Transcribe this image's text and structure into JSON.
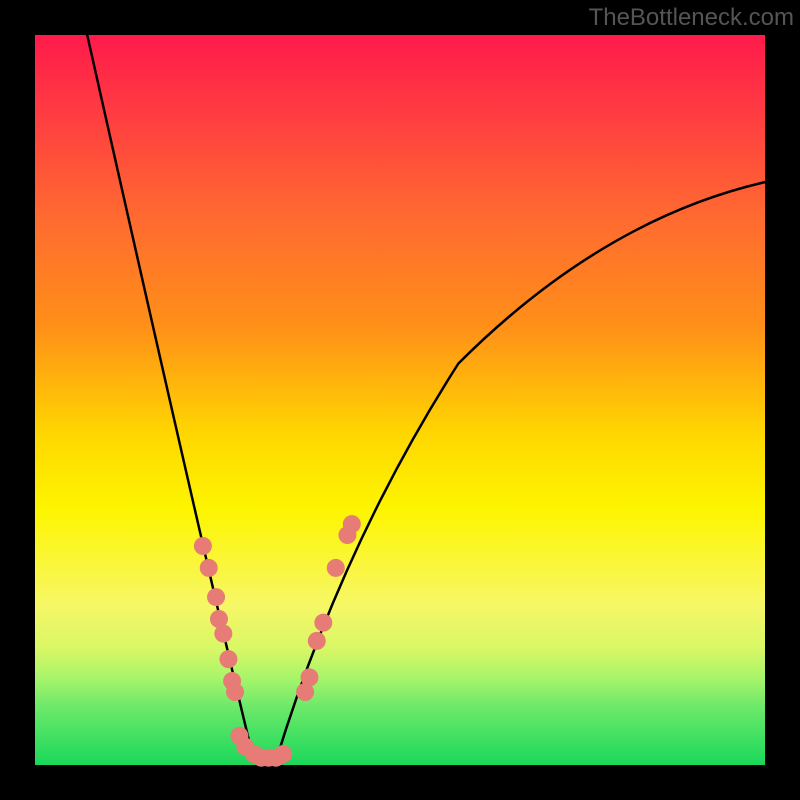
{
  "watermark": "TheBottleneck.com",
  "chart_data": {
    "type": "line",
    "title": "",
    "xlabel": "",
    "ylabel": "",
    "curve_left": {
      "description": "steep descending limb from top-left into the valley",
      "y_start_pct": 0,
      "y_end_pct": 100,
      "x_start_pct": 7,
      "x_end_pct": 30
    },
    "curve_right": {
      "description": "ascending limb from valley toward upper right, concave, flattening",
      "y_start_pct": 100,
      "y_end_pct": 20,
      "x_start_pct": 33,
      "x_end_pct": 100
    },
    "valley_x_pct": 31,
    "markers_left": [
      {
        "x_pct": 23.0,
        "y_pct": 70.0
      },
      {
        "x_pct": 23.8,
        "y_pct": 73.0
      },
      {
        "x_pct": 24.8,
        "y_pct": 77.0
      },
      {
        "x_pct": 25.2,
        "y_pct": 80.0
      },
      {
        "x_pct": 25.8,
        "y_pct": 82.0
      },
      {
        "x_pct": 26.5,
        "y_pct": 85.5
      },
      {
        "x_pct": 27.0,
        "y_pct": 88.5
      },
      {
        "x_pct": 27.4,
        "y_pct": 90.0
      }
    ],
    "markers_right": [
      {
        "x_pct": 37.0,
        "y_pct": 90.0
      },
      {
        "x_pct": 37.6,
        "y_pct": 88.0
      },
      {
        "x_pct": 38.6,
        "y_pct": 83.0
      },
      {
        "x_pct": 39.5,
        "y_pct": 80.5
      },
      {
        "x_pct": 41.2,
        "y_pct": 73.0
      },
      {
        "x_pct": 42.8,
        "y_pct": 68.5
      },
      {
        "x_pct": 43.4,
        "y_pct": 67.0
      }
    ],
    "markers_valley": [
      {
        "x_pct": 28.0,
        "y_pct": 96.0
      },
      {
        "x_pct": 28.8,
        "y_pct": 97.5
      },
      {
        "x_pct": 30.0,
        "y_pct": 98.5
      },
      {
        "x_pct": 31.0,
        "y_pct": 99.0
      },
      {
        "x_pct": 32.0,
        "y_pct": 99.0
      },
      {
        "x_pct": 33.0,
        "y_pct": 99.0
      },
      {
        "x_pct": 34.0,
        "y_pct": 98.5
      }
    ],
    "gradient_stops": [
      {
        "pct": 0,
        "color": "#ff1a4b"
      },
      {
        "pct": 55,
        "color": "#ffd800"
      },
      {
        "pct": 100,
        "color": "#1ad85a"
      }
    ]
  },
  "dot_radius_px": 9
}
